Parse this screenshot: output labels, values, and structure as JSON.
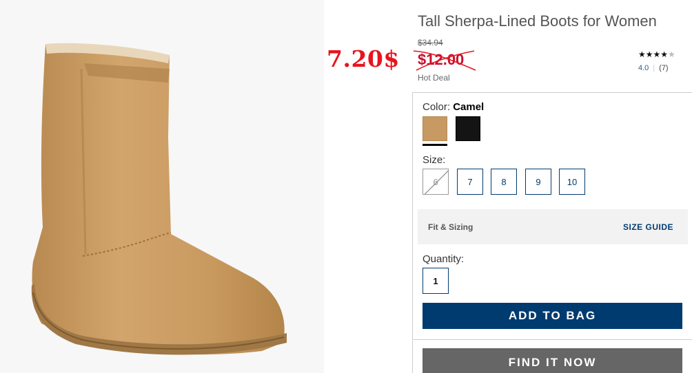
{
  "product": {
    "title": "Tall Sherpa-Lined Boots for Women",
    "original_price": "$34.94",
    "sale_price": "$12.00",
    "overlay_price": "7.20$",
    "deal_label": "Hot Deal",
    "rating": {
      "stars_filled": "★★★★",
      "stars_empty": "★",
      "value": "4.0",
      "count": "(7)"
    }
  },
  "color": {
    "label": "Color:",
    "selected": "Camel",
    "swatches": [
      {
        "name": "Camel",
        "hex": "#c69a62"
      },
      {
        "name": "Black",
        "hex": "#141414"
      }
    ]
  },
  "size": {
    "label": "Size:",
    "options": [
      "6",
      "7",
      "8",
      "9",
      "10"
    ],
    "unavailable": [
      "6"
    ]
  },
  "fit": {
    "label": "Fit & Sizing",
    "guide_link": "SIZE GUIDE"
  },
  "quantity": {
    "label": "Quantity:",
    "value": "1"
  },
  "actions": {
    "add_to_bag": "ADD TO BAG",
    "find_it_now": "FIND IT NOW"
  },
  "colors": {
    "accent": "#003b6f",
    "sale": "#c8102e",
    "overlay": "#e8141c",
    "secondary_button": "#666666"
  }
}
